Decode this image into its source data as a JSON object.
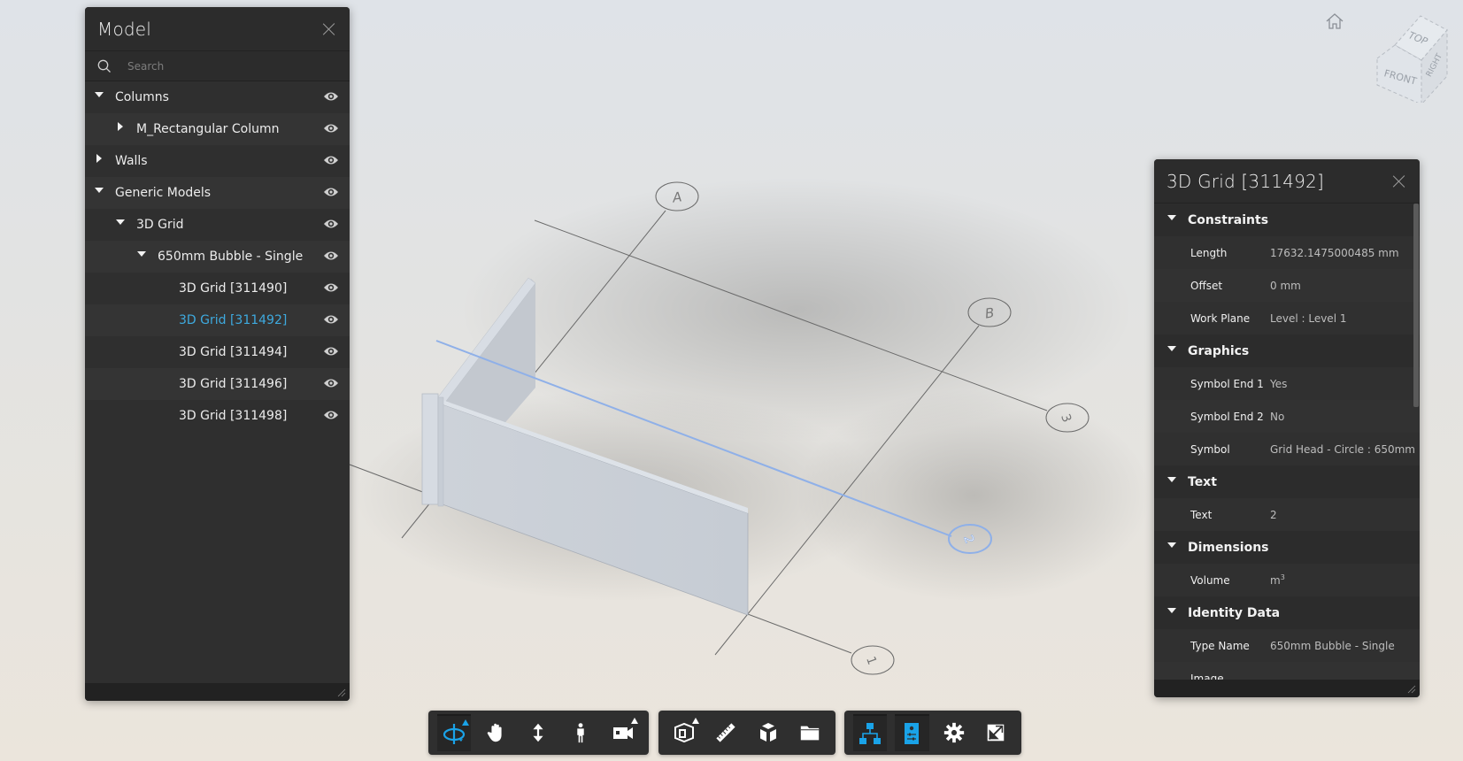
{
  "model_panel": {
    "title": "Model",
    "search_placeholder": "Search",
    "tree": [
      {
        "label": "Columns",
        "depth": 0,
        "expander": "down",
        "selected": false
      },
      {
        "label": "M_Rectangular Column",
        "depth": 1,
        "expander": "right",
        "selected": false
      },
      {
        "label": "Walls",
        "depth": 0,
        "expander": "right",
        "selected": false
      },
      {
        "label": "Generic Models",
        "depth": 0,
        "expander": "down",
        "selected": false
      },
      {
        "label": "3D Grid",
        "depth": 1,
        "expander": "down",
        "selected": false
      },
      {
        "label": "650mm Bubble - Single",
        "depth": 2,
        "expander": "down",
        "selected": false
      },
      {
        "label": "3D Grid [311490]",
        "depth": 3,
        "expander": "none",
        "selected": false
      },
      {
        "label": "3D Grid [311492]",
        "depth": 3,
        "expander": "none",
        "selected": true
      },
      {
        "label": "3D Grid [311494]",
        "depth": 3,
        "expander": "none",
        "selected": false
      },
      {
        "label": "3D Grid [311496]",
        "depth": 3,
        "expander": "none",
        "selected": false
      },
      {
        "label": "3D Grid [311498]",
        "depth": 3,
        "expander": "none",
        "selected": false
      }
    ]
  },
  "properties_panel": {
    "title": "3D Grid [311492]",
    "sections": [
      {
        "name": "Constraints",
        "rows": [
          {
            "name": "Length",
            "value": "17632.1475000485 mm"
          },
          {
            "name": "Offset",
            "value": "0 mm"
          },
          {
            "name": "Work Plane",
            "value": "Level : Level 1"
          }
        ]
      },
      {
        "name": "Graphics",
        "rows": [
          {
            "name": "Symbol End 1",
            "value": "Yes"
          },
          {
            "name": "Symbol End 2",
            "value": "No"
          },
          {
            "name": "Symbol",
            "value": "Grid Head - Circle : 650mm"
          }
        ]
      },
      {
        "name": "Text",
        "rows": [
          {
            "name": "Text",
            "value": "2"
          }
        ]
      },
      {
        "name": "Dimensions",
        "rows": [
          {
            "name": "Volume",
            "value": "m",
            "superscript": "3"
          }
        ]
      },
      {
        "name": "Identity Data",
        "rows": [
          {
            "name": "Type Name",
            "value": "650mm Bubble - Single"
          },
          {
            "name": "Image",
            "value": ""
          }
        ]
      }
    ]
  },
  "viewcube": {
    "top": "TOP",
    "front": "FRONT",
    "right": "RIGHT"
  },
  "scene": {
    "grid_labels": [
      "A",
      "B",
      "3",
      "2",
      "1"
    ],
    "selected_grid": "2",
    "highlight_color": "#8fb0e8"
  },
  "toolbar": {
    "accent_color": "#1aa3e8",
    "groups": [
      [
        {
          "name": "orbit",
          "icon": "orbit-icon",
          "active": true,
          "flyout": true
        },
        {
          "name": "pan",
          "icon": "pan-hand-icon",
          "active": false,
          "flyout": false
        },
        {
          "name": "zoom",
          "icon": "zoom-updown-icon",
          "active": false,
          "flyout": false
        },
        {
          "name": "first-person",
          "icon": "walk-person-icon",
          "active": false,
          "flyout": false
        },
        {
          "name": "camera",
          "icon": "camera-icon",
          "active": false,
          "flyout": true
        }
      ],
      [
        {
          "name": "section",
          "icon": "section-box-icon",
          "active": false,
          "flyout": true
        },
        {
          "name": "measure",
          "icon": "ruler-icon",
          "active": false,
          "flyout": false
        },
        {
          "name": "explode",
          "icon": "explode-cube-icon",
          "active": false,
          "flyout": false
        },
        {
          "name": "model-browser",
          "icon": "folder-icon",
          "active": false,
          "flyout": false
        }
      ],
      [
        {
          "name": "model-structure",
          "icon": "hierarchy-icon",
          "active": true,
          "flyout": false
        },
        {
          "name": "properties",
          "icon": "properties-icon",
          "active": true,
          "flyout": false
        },
        {
          "name": "settings",
          "icon": "gear-icon",
          "active": false,
          "flyout": false
        },
        {
          "name": "fullscreen",
          "icon": "fullscreen-icon",
          "active": false,
          "flyout": false
        }
      ]
    ]
  }
}
